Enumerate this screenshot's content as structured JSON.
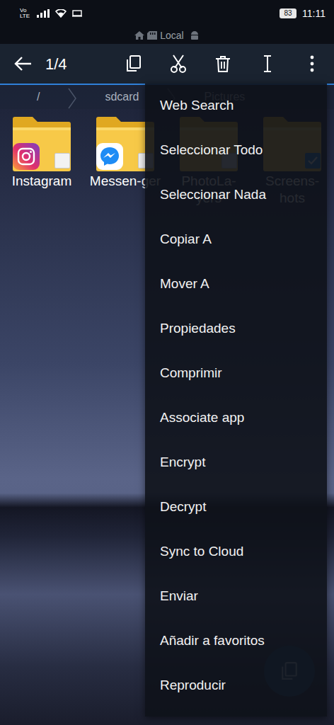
{
  "status_bar": {
    "network": "Vo LTE",
    "battery": "83",
    "time": "11:11"
  },
  "location": {
    "label": "Local"
  },
  "toolbar": {
    "count": "1/4"
  },
  "breadcrumb": [
    "/",
    "sdcard",
    "Pictures"
  ],
  "folders": [
    {
      "label": "Instagram",
      "kind": "instagram",
      "selected": false
    },
    {
      "label": "Messen-ger",
      "kind": "messenger",
      "selected": false
    },
    {
      "label": "PhotoLa-yers",
      "kind": "plain",
      "selected": false
    },
    {
      "label": "Screens-hots",
      "kind": "plain",
      "selected": true
    }
  ],
  "menu": {
    "items": [
      "Web Search",
      "Seleccionar Todo",
      "Seleccionar Nada",
      "Copiar A",
      "Mover A",
      "Propiedades",
      "Comprimir",
      "Associate app",
      "Encrypt",
      "Decrypt",
      "Sync to Cloud",
      "Enviar",
      "Añadir a favoritos",
      "Reproducir"
    ]
  }
}
